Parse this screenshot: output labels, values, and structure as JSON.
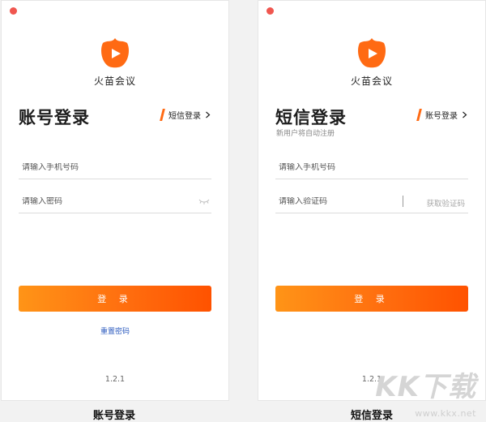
{
  "brand_color": "#ff6a13",
  "link_color": "#2c5bbf",
  "left_panel": {
    "app_name": "火苗会议",
    "title": "账号登录",
    "switch_label": "短信登录",
    "phone_placeholder": "请输入手机号码",
    "password_placeholder": "请输入密码",
    "login_label": "登 录",
    "reset_link": "重置密码",
    "version": "1.2.1"
  },
  "right_panel": {
    "app_name": "火苗会议",
    "title": "短信登录",
    "subtitle": "新用户将自动注册",
    "switch_label": "账号登录",
    "phone_placeholder": "请输入手机号码",
    "code_placeholder": "请输入验证码",
    "get_code_label": "获取验证码",
    "login_label": "登 录",
    "version": "1.2.1"
  },
  "captions": {
    "left": "账号登录",
    "right": "短信登录"
  },
  "watermark": {
    "text": "KK下载",
    "url": "www.kkx.net"
  },
  "icons": [
    "close-dot-icon",
    "flame-logo-icon",
    "chevron-right-icon",
    "eye-closed-icon"
  ]
}
